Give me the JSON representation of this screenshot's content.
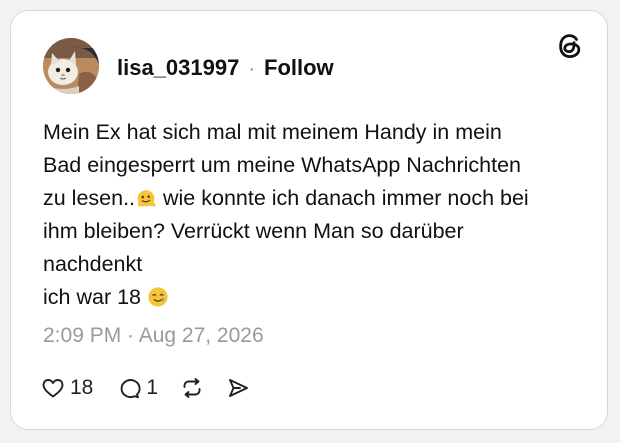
{
  "post": {
    "username": "lisa_031997",
    "separator": "·",
    "follow_label": "Follow",
    "text_line1": "Mein Ex hat sich mal mit meinem Handy in mein",
    "text_line2": "Bad eingesperrt um meine WhatsApp Nachrichten",
    "text_line3a": "zu lesen..",
    "text_line3b": " wie konnte ich danach immer noch bei",
    "text_line4": "ihm bleiben? Verrückt wenn Man so darüber",
    "text_line5": "nachdenkt",
    "text_line6": "ich war 18 ",
    "emoji_1": "melting-face-emoji",
    "emoji_2": "smiling-face-with-tear-emoji",
    "timestamp": "2:09 PM · Aug 27, 2026",
    "likes": "18",
    "replies": "1"
  },
  "icons": {
    "brand": "threads-logo-icon",
    "like": "heart-icon",
    "reply": "speech-bubble-icon",
    "repost": "repost-icon",
    "share": "send-icon"
  },
  "colors": {
    "text": "#111111",
    "muted": "#9a9a9a",
    "background": "#f2f2f2",
    "card": "#ffffff"
  }
}
